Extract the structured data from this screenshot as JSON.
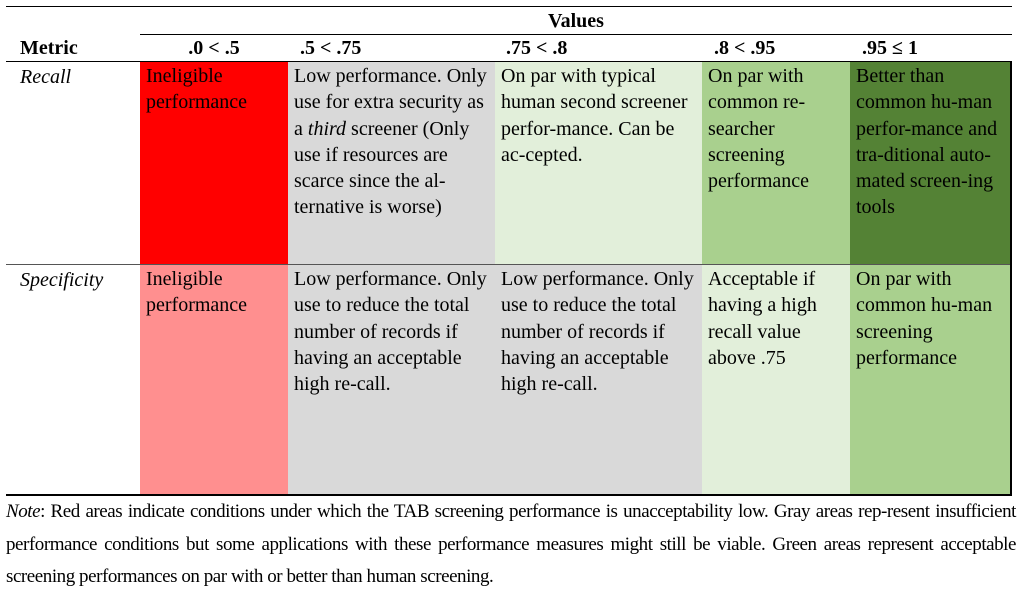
{
  "table": {
    "group_header": "Values",
    "metric_header": "Metric",
    "columns": [
      ".0 < .5",
      ".5 < .75",
      ".75 < .8",
      ".8 < .95",
      ".95 ≤ 1"
    ],
    "rows": [
      {
        "metric": "Recall",
        "cells": [
          {
            "text": "Ineligible performance",
            "color": "#ff0000"
          },
          {
            "text_before": "Low performance. Only use for extra security as a ",
            "text_italic": "third",
            "text_after": " screener (Only use if resources are scarce since the al-ternative is worse)",
            "color": "#d9d9d9"
          },
          {
            "text": "On par with typical human second screener perfor-mance. Can be ac-cepted.",
            "color": "#e2efda"
          },
          {
            "text": "On par with common re-searcher screening performance",
            "color": "#a9d08e"
          },
          {
            "text": "Better than common hu-man perfor-mance and tra-ditional auto-mated screen-ing tools",
            "color": "#548235"
          }
        ]
      },
      {
        "metric": "Specificity",
        "cells": [
          {
            "text": "Ineligible performance",
            "color": "#ff8f8f"
          },
          {
            "text": "Low performance. Only use to reduce the total number of records if having an acceptable high re-call.",
            "color": "#d9d9d9"
          },
          {
            "text": "Low performance. Only use to reduce the total number of records if having an acceptable high re-call.",
            "color": "#d9d9d9"
          },
          {
            "text": "Acceptable if having a high recall value above .75",
            "color": "#e2efda"
          },
          {
            "text": "On par with common hu-man screening performance",
            "color": "#a9d08e"
          }
        ]
      }
    ]
  },
  "note": {
    "label": "Note",
    "text": ": Red areas indicate conditions under which the TAB screening performance is unacceptability low. Gray areas rep-resent insufficient performance conditions but some applications with these performance measures might still be viable. Green areas represent acceptable screening performances on par with or better than human screening."
  }
}
